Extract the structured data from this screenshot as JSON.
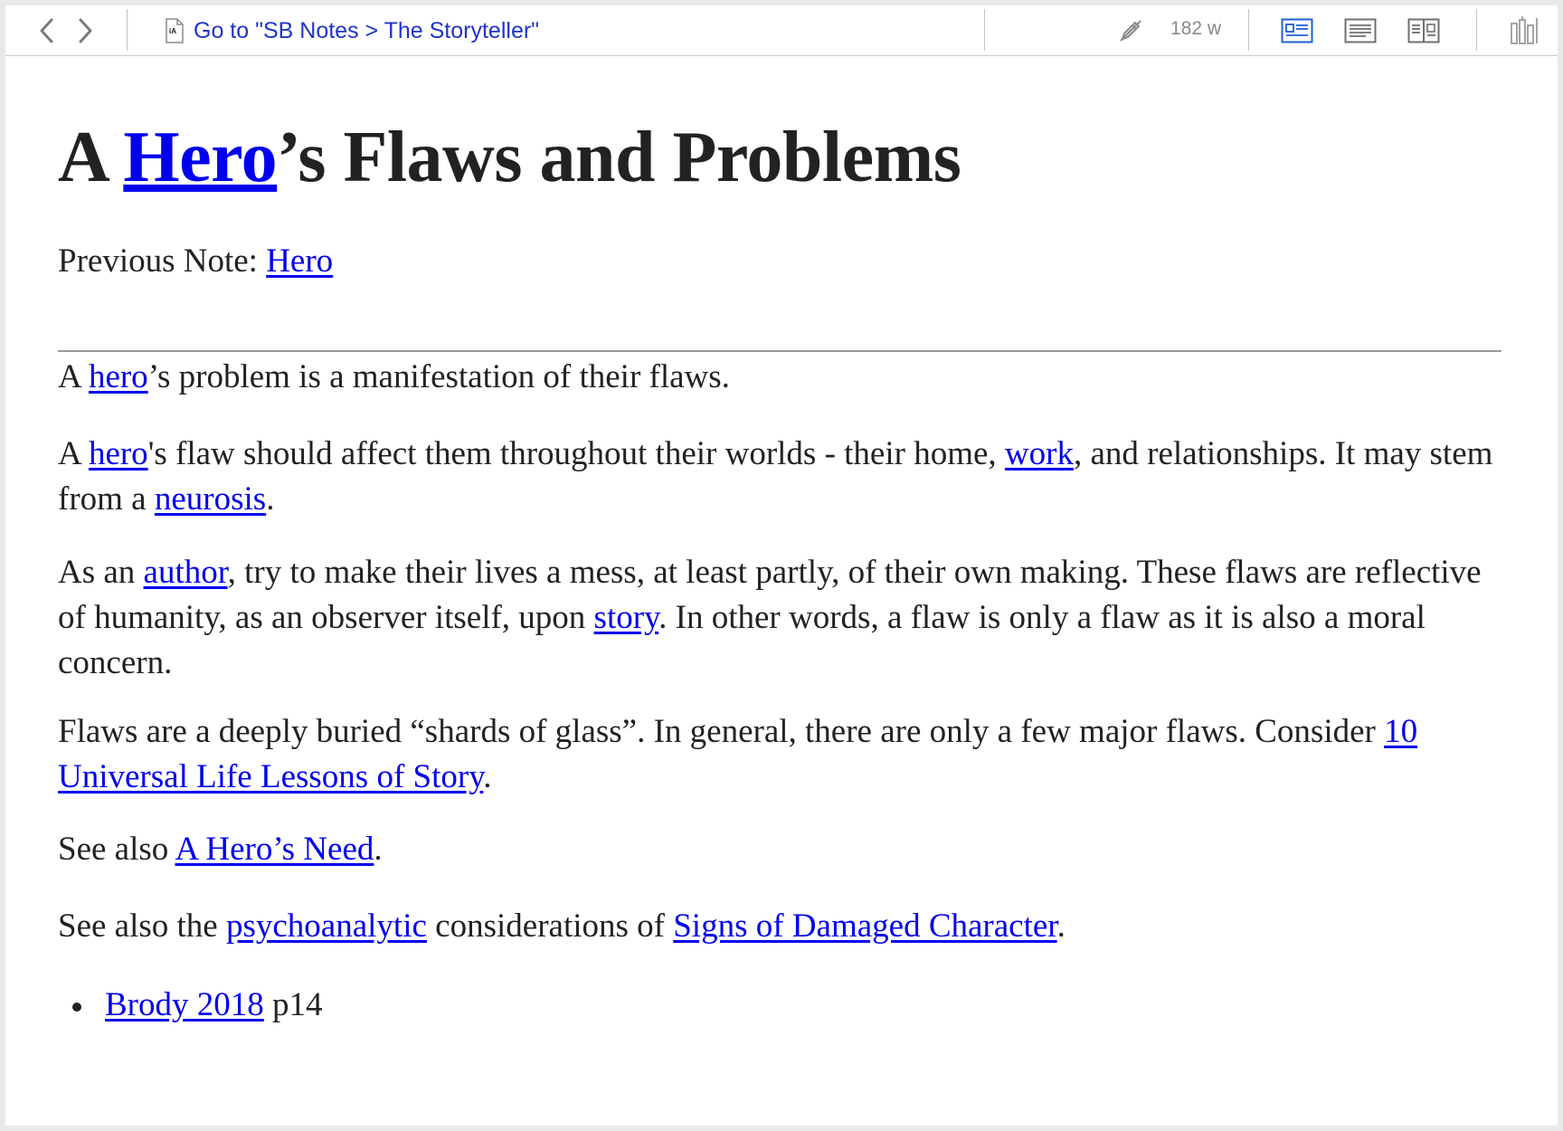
{
  "toolbar": {
    "goto_label": "Go to \"SB Notes > The Storyteller\"",
    "word_count": "182 w",
    "doc_icon_text": "iA"
  },
  "article": {
    "title_prefix": "A ",
    "title_link": "Hero",
    "title_suffix": "’s Flaws and Problems",
    "prev_label": "Previous Note: ",
    "prev_link": "Hero",
    "p1": {
      "a": "A ",
      "link1": "hero",
      "b": "’s problem is a manifestation of their flaws."
    },
    "p2": {
      "a": "A ",
      "link1": "hero",
      "b": "'s flaw should affect them throughout their worlds - their home, ",
      "link2": "work",
      "c": ", and relationships. It may stem from a ",
      "link3": "neurosis",
      "d": "."
    },
    "p3": {
      "a": "As an ",
      "link1": "author",
      "b": ", try to make their lives a mess, at least partly, of their own making. These flaws are reflective of humanity, as an observer itself, upon ",
      "link2": "story",
      "c": ". In other words, a flaw is only a flaw as it is also a moral concern."
    },
    "p4": {
      "a": "Flaws are a deeply buried “shards of glass”. In general, there are only a few major flaws. Consider ",
      "link1": "10 Universal Life Lessons of Story",
      "b": "."
    },
    "p5": {
      "a": "See also ",
      "link1": "A Hero’s Need",
      "b": "."
    },
    "p6": {
      "a": "See also the ",
      "link1": "psychoanalytic",
      "b": " considerations of ",
      "link2": "Signs of Damaged Character",
      "c": "."
    },
    "list": [
      {
        "link": "Brody 2018",
        "text": " p14"
      }
    ]
  }
}
